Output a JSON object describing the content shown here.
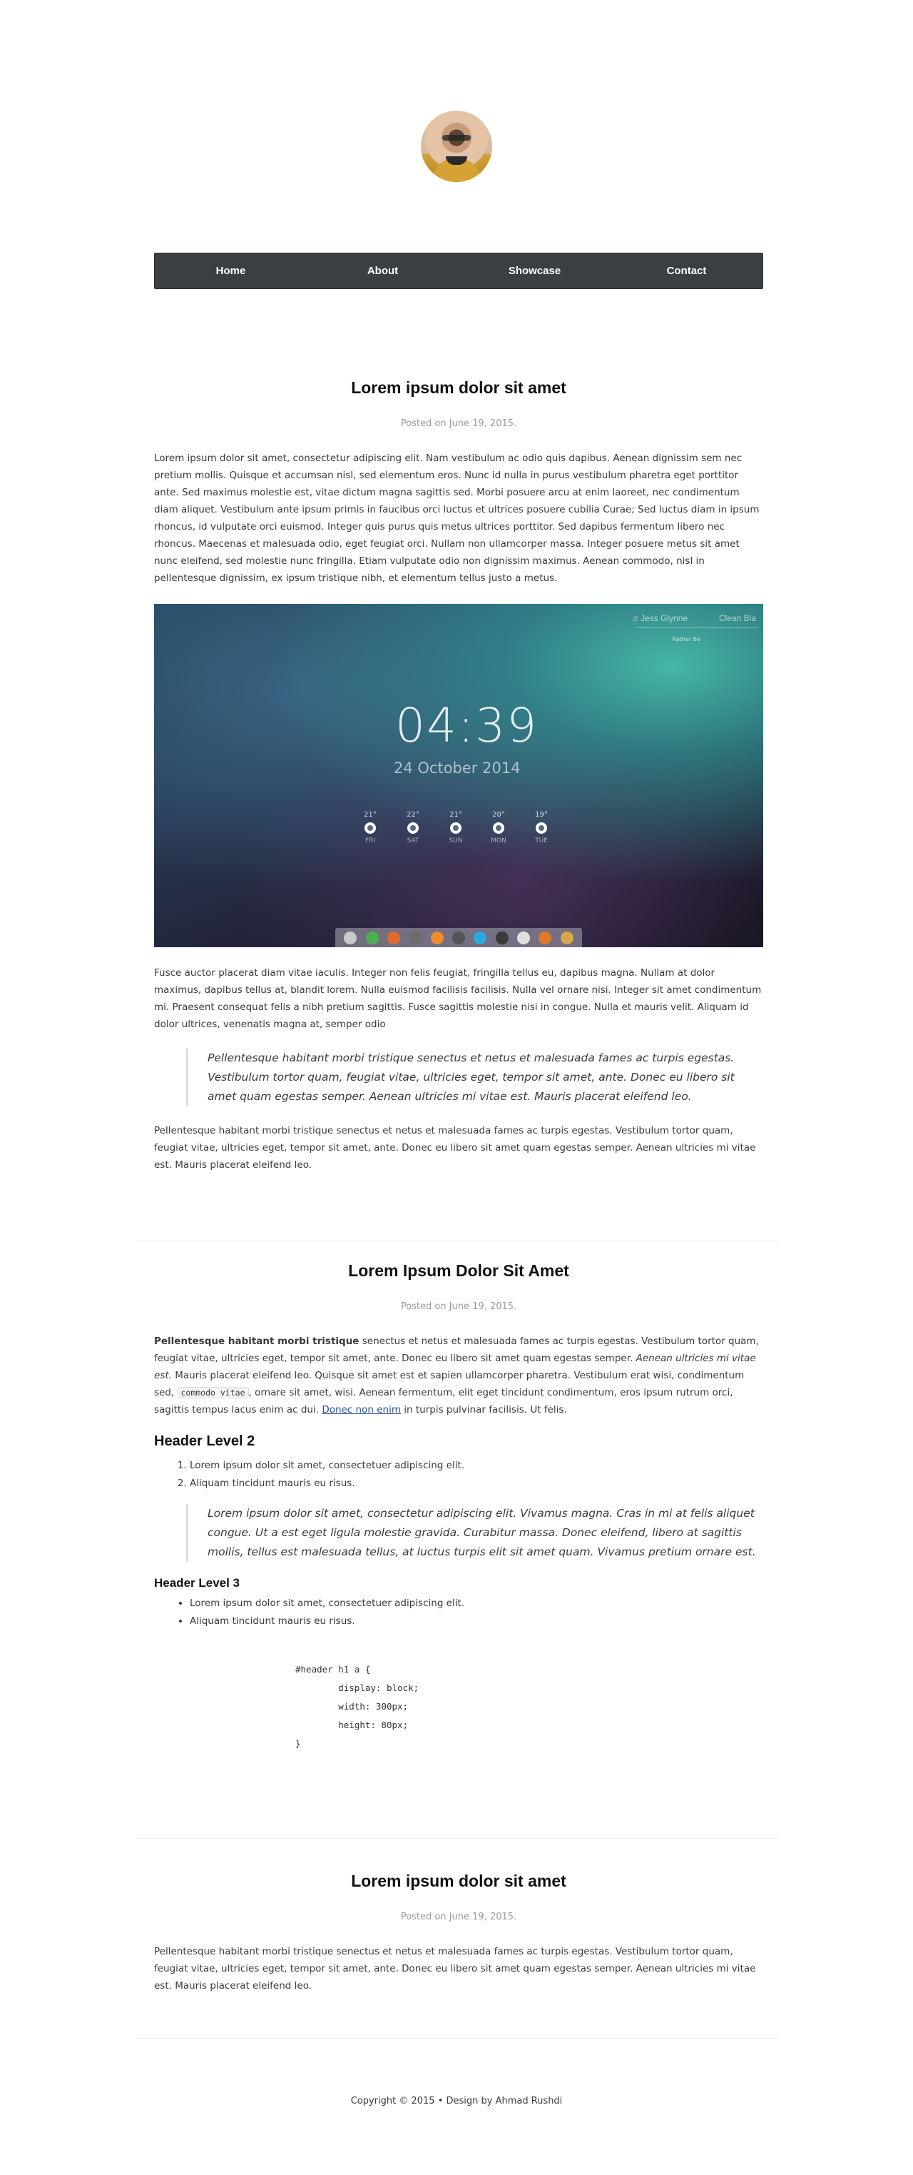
{
  "nav": {
    "items": [
      "Home",
      "About",
      "Showcase",
      "Contact"
    ]
  },
  "posts": [
    {
      "title": "Lorem ipsum dolor sit amet",
      "meta": "Posted on June 19, 2015.",
      "p1": "Lorem ipsum dolor sit amet, consectetur adipiscing elit. Nam vestibulum ac odio quis dapibus. Aenean dignissim sem nec pretium mollis. Quisque et accumsan nisl, sed elementum eros. Nunc id nulla in purus vestibulum pharetra eget porttitor ante. Sed maximus molestie est, vitae dictum magna sagittis sed. Morbi posuere arcu at enim laoreet, nec condimentum diam aliquet. Vestibulum ante ipsum primis in faucibus orci luctus et ultrices posuere cubilia Curae; Sed luctus diam in ipsum rhoncus, id vulputate orci euismod. Integer quis purus quis metus ultrices porttitor. Sed dapibus fermentum libero nec rhoncus. Maecenas et malesuada odio, eget feugiat orci. Nullam non ullamcorper massa. Integer posuere metus sit amet nunc eleifend, sed molestie nunc fringilla. Etiam vulputate odio non dignissim maximus. Aenean commodo, nisl in pellentesque dignissim, ex ipsum tristique nibh, et elementum tellus justo a metus.",
      "screenshot": {
        "user": "Jess Glynne",
        "theme": "Clean Bla",
        "sub": "Rather Be",
        "time": "04:39",
        "date": "24 October 2014",
        "weather": [
          {
            "temp": "21°",
            "day": "FRI"
          },
          {
            "temp": "22°",
            "day": "SAT"
          },
          {
            "temp": "21°",
            "day": "SUN"
          },
          {
            "temp": "20°",
            "day": "MON"
          },
          {
            "temp": "19°",
            "day": "TUE"
          }
        ],
        "dock_colors": [
          "#c9c9c9",
          "#4caf50",
          "#e06a2b",
          "#6b6b6b",
          "#f08c2a",
          "#555555",
          "#2aa9e0",
          "#3a3a3a",
          "#e0e0e0",
          "#e07a2a",
          "#d8a84a"
        ]
      },
      "p2": "Fusce auctor placerat diam vitae iaculis. Integer non felis feugiat, fringilla tellus eu, dapibus magna. Nullam at dolor maximus, dapibus tellus at, blandit lorem. Nulla euismod facilisis facilisis. Nulla vel ornare nisi. Integer sit amet condimentum mi. Praesent consequat felis a nibh pretium sagittis. Fusce sagittis molestie nisi in congue. Nulla et mauris velit. Aliquam id dolor ultrices, venenatis magna at, semper odio",
      "quote": "Pellentesque habitant morbi tristique senectus et netus et malesuada fames ac turpis egestas. Vestibulum tortor quam, feugiat vitae, ultricies eget, tempor sit amet, ante. Donec eu libero sit amet quam egestas semper. Aenean ultricies mi vitae est. Mauris placerat eleifend leo.",
      "p3": "Pellentesque habitant morbi tristique senectus et netus et malesuada fames ac turpis egestas. Vestibulum tortor quam, feugiat vitae, ultricies eget, tempor sit amet, ante. Donec eu libero sit amet quam egestas semper. Aenean ultricies mi vitae est. Mauris placerat eleifend leo."
    },
    {
      "title": "Lorem Ipsum Dolor Sit Amet",
      "meta": "Posted on June 19, 2015.",
      "p_bold": "Pellentesque habitant morbi tristique",
      "p_a": " senectus et netus et malesuada fames ac turpis egestas. Vestibulum tortor quam, feugiat vitae, ultricies eget, tempor sit amet, ante. Donec eu libero sit amet quam egestas semper. ",
      "p_em": "Aenean ultricies mi vitae est.",
      "p_b": " Mauris placerat eleifend leo. Quisque sit amet est et sapien ullamcorper pharetra. Vestibulum erat wisi, condimentum sed, ",
      "p_code": "commodo vitae",
      "p_c": ", ornare sit amet, wisi. Aenean fermentum, elit eget tincidunt condimentum, eros ipsum rutrum orci, sagittis tempus lacus enim ac dui. ",
      "p_link": "Donec non enim",
      "p_d": " in turpis pulvinar facilisis. Ut felis.",
      "h2": "Header Level 2",
      "ol": [
        "Lorem ipsum dolor sit amet, consectetuer adipiscing elit.",
        "Aliquam tincidunt mauris eu risus."
      ],
      "quote": "Lorem ipsum dolor sit amet, consectetur adipiscing elit. Vivamus magna. Cras in mi at felis aliquet congue. Ut a est eget ligula molestie gravida. Curabitur massa. Donec eleifend, libero at sagittis mollis, tellus est malesuada tellus, at luctus turpis elit sit amet quam. Vivamus pretium ornare est.",
      "h3": "Header Level 3",
      "ul": [
        "Lorem ipsum dolor sit amet, consectetuer adipiscing elit.",
        "Aliquam tincidunt mauris eu risus."
      ],
      "code": "#header h1 a {\n\tdisplay: block;\n\twidth: 300px;\n\theight: 80px;\n}"
    },
    {
      "title": "Lorem ipsum dolor sit amet",
      "meta": "Posted on June 19, 2015.",
      "p1": "Pellentesque habitant morbi tristique senectus et netus et malesuada fames ac turpis egestas. Vestibulum tortor quam, feugiat vitae, ultricies eget, tempor sit amet, ante. Donec eu libero sit amet quam egestas semper. Aenean ultricies mi vitae est. Mauris placerat eleifend leo."
    }
  ],
  "footer": {
    "text": "Copyright © 2015 • Design by Ahmad Rushdi"
  }
}
